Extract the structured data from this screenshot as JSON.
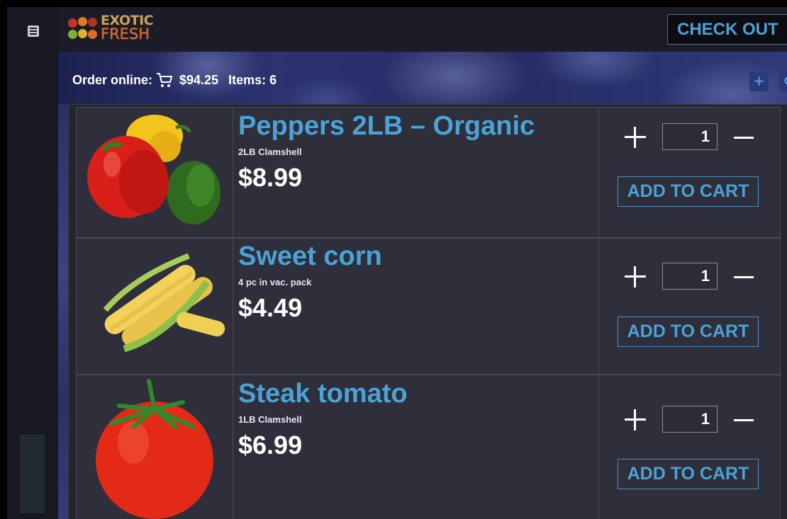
{
  "brand": {
    "logo_line1": "EXOTIC",
    "logo_line2": "FRESH"
  },
  "header": {
    "checkout_label": "CHECK OUT"
  },
  "order_bar": {
    "label": "Order online:",
    "cart_total": "$94.25",
    "items_label": "Items: 6"
  },
  "toolbar": {
    "add_icon": "plus-icon",
    "search_icon": "search-icon"
  },
  "products": [
    {
      "name": "Peppers 2LB – Organic",
      "pack": "2LB Clamshell",
      "price": "$8.99",
      "qty": "1",
      "add_label": "ADD TO CART",
      "image": "bell-peppers"
    },
    {
      "name": "Sweet corn",
      "pack": "4 pc in vac. pack",
      "price": "$4.49",
      "qty": "1",
      "add_label": "ADD TO CART",
      "image": "corn-cobs"
    },
    {
      "name": "Steak tomato",
      "pack": "1LB Clamshell",
      "price": "$6.99",
      "qty": "1",
      "add_label": "ADD TO CART",
      "image": "tomato"
    }
  ],
  "colors": {
    "accent": "#4aa3d8",
    "background": "#1c1b26",
    "row_background": "#2e2f3a"
  }
}
